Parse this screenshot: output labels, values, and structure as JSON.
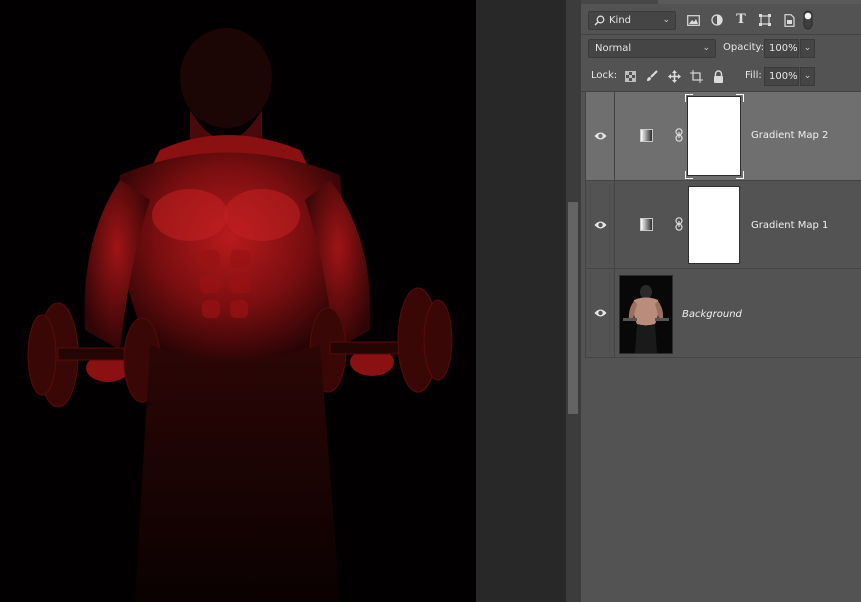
{
  "filter": {
    "kind_label": "Kind"
  },
  "blend": {
    "mode": "Normal",
    "opacity_label": "Opacity:",
    "opacity_value": "100%"
  },
  "lock": {
    "label": "Lock:",
    "fill_label": "Fill:",
    "fill_value": "100%"
  },
  "layers": [
    {
      "name": "Gradient Map 2",
      "visible": true,
      "selected": true
    },
    {
      "name": "Gradient Map 1",
      "visible": true,
      "selected": false
    },
    {
      "name": "Background",
      "visible": true,
      "selected": false
    }
  ],
  "colors": {
    "accent_red": "#c0161a",
    "panel_bg": "#535353",
    "selected_row": "#6f6f6f",
    "canvas_bg": "#020000"
  },
  "icons": [
    "search-icon",
    "image-filter-icon",
    "adjustment-filter-icon",
    "type-filter-icon",
    "shape-filter-icon",
    "smart-object-filter-icon",
    "filter-toggle-icon",
    "lock-transparent-icon",
    "lock-brush-icon",
    "lock-move-icon",
    "lock-artboard-icon",
    "lock-all-icon",
    "eye-icon",
    "gradient-map-icon",
    "chain-link-icon"
  ]
}
